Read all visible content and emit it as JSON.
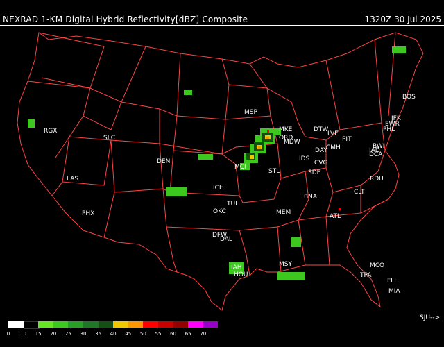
{
  "header": {
    "title": "NEXRAD 1-KM Digital Hybrid Reflectivity[dBZ] Composite",
    "timestamp": "1320Z 30 Jul 2025"
  },
  "cities": [
    "BOS",
    "JFK",
    "EWR",
    "PHL",
    "BWI",
    "IAD",
    "DCA",
    "PIT",
    "CMH",
    "LVE",
    "DTW",
    "DAY",
    "CVG",
    "SDF",
    "IDS",
    "ORD",
    "MKE",
    "MDW",
    "MSP",
    "STL",
    "MCI",
    "ICH",
    "DEN",
    "SLC",
    "RGX",
    "LAS",
    "PHX",
    "TUL",
    "OKC",
    "DFW",
    "DAL",
    "IAH",
    "HOU",
    "MSY",
    "MEM",
    "BNA",
    "ATL",
    "CLT",
    "RDU",
    "MCO",
    "TPA",
    "FLL",
    "MIA"
  ],
  "legend": {
    "ticks": [
      "0",
      "10",
      "15",
      "20",
      "25",
      "30",
      "35",
      "40",
      "45",
      "50",
      "55",
      "60",
      "65",
      "70"
    ],
    "colors": [
      "#ffffff",
      "#000000",
      "#64e622",
      "#3cc81e",
      "#28a028",
      "#1e7828",
      "#145014",
      "#f0c800",
      "#ff9600",
      "#ff0000",
      "#c80000",
      "#960000",
      "#ff00ff",
      "#9600c8"
    ]
  },
  "footer_note": "SJU-->",
  "colors": {
    "borders": "#ff4444",
    "background": "#000000"
  }
}
